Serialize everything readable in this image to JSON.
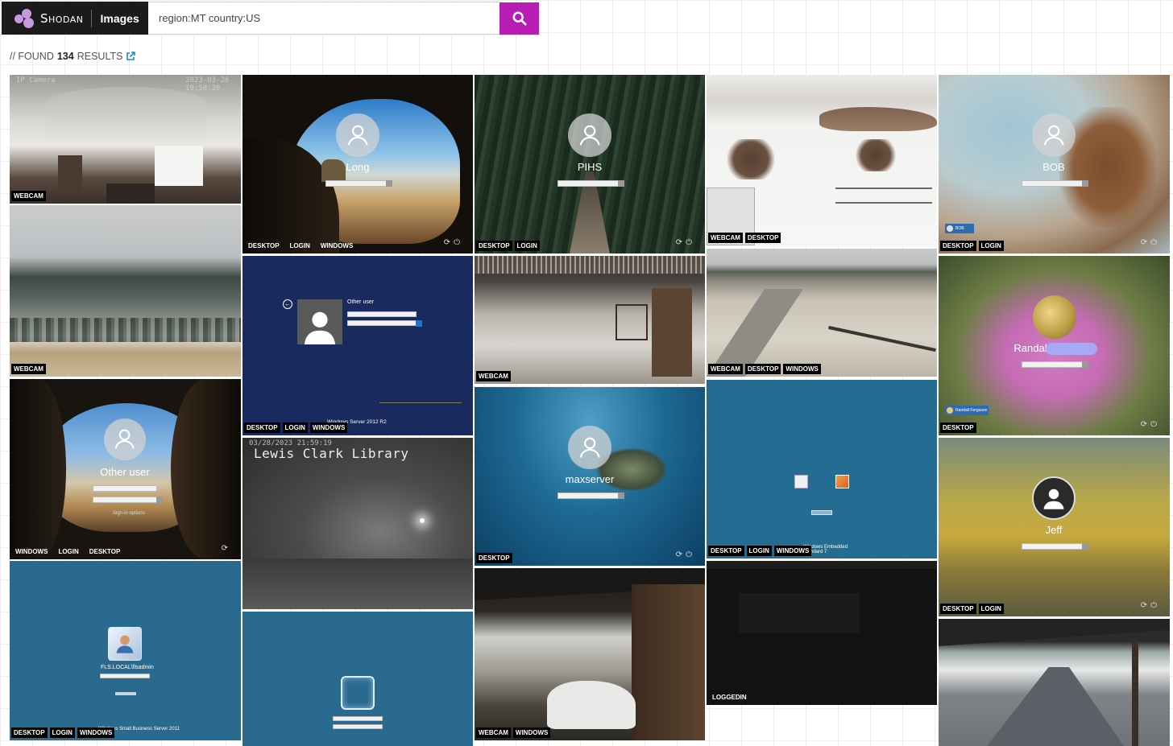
{
  "header": {
    "brand_name": "Shodan",
    "section_label": "Images",
    "search_value": "region:MT country:US",
    "search_icon": "search-icon",
    "accent_color": "#b81db3"
  },
  "results": {
    "prefix": "// FOUND",
    "count": "134",
    "suffix": "RESULTS",
    "link_icon": "external-link-icon"
  },
  "tiles": [
    {
      "tags": [
        "WEBCAM"
      ],
      "cam_time": "2023-03-28 19:58:20",
      "cam_label": "IP Camera"
    },
    {
      "tags": [
        "DESKTOP",
        "LOGIN",
        "WINDOWS"
      ],
      "username": "Long"
    },
    {
      "tags": [
        "DESKTOP",
        "LOGIN"
      ],
      "username": "PIHS"
    },
    {
      "tags": [
        "WEBCAM",
        "DESKTOP"
      ]
    },
    {
      "tags": [
        "DESKTOP",
        "LOGIN"
      ],
      "username": "BOB",
      "mini_user": "BOB"
    },
    {
      "tags": [
        "WEBCAM"
      ]
    },
    {
      "tags": [
        "DESKTOP",
        "LOGIN",
        "WINDOWS"
      ],
      "username": "Other user",
      "os_text": "Windows Server 2012 R2"
    },
    {
      "tags": [
        "WEBCAM"
      ]
    },
    {
      "tags": [
        "WEBCAM",
        "DESKTOP",
        "WINDOWS"
      ]
    },
    {
      "tags": [
        "DESKTOP"
      ],
      "username": "Randal",
      "mini_user": "Randall Ferguson"
    },
    {
      "tags": [
        "WINDOWS",
        "LOGIN",
        "DESKTOP"
      ],
      "username": "Other user",
      "hint": "Sign-in options"
    },
    {
      "tags": [],
      "cam_time": "03/28/2023 21:59:19",
      "cam_label": "Lewis Clark Library"
    },
    {
      "tags": [
        "DESKTOP"
      ],
      "username": "maxserver"
    },
    {
      "tags": [
        "DESKTOP",
        "LOGIN",
        "WINDOWS"
      ],
      "os_text": "Windows Embedded Standard 7"
    },
    {
      "tags": [
        "DESKTOP",
        "LOGIN"
      ],
      "username": "Jeff"
    },
    {
      "tags": [
        "DESKTOP",
        "LOGIN",
        "WINDOWS"
      ],
      "username": "FLS.LOCAL\\flsadmin",
      "os_text": "Windows Small Business Server 2011"
    },
    {
      "tags": [
        "LOGGEDIN"
      ]
    },
    {
      "tags": []
    },
    {
      "tags": [
        "WEBCAM",
        "WINDOWS"
      ]
    },
    {
      "tags": []
    }
  ]
}
